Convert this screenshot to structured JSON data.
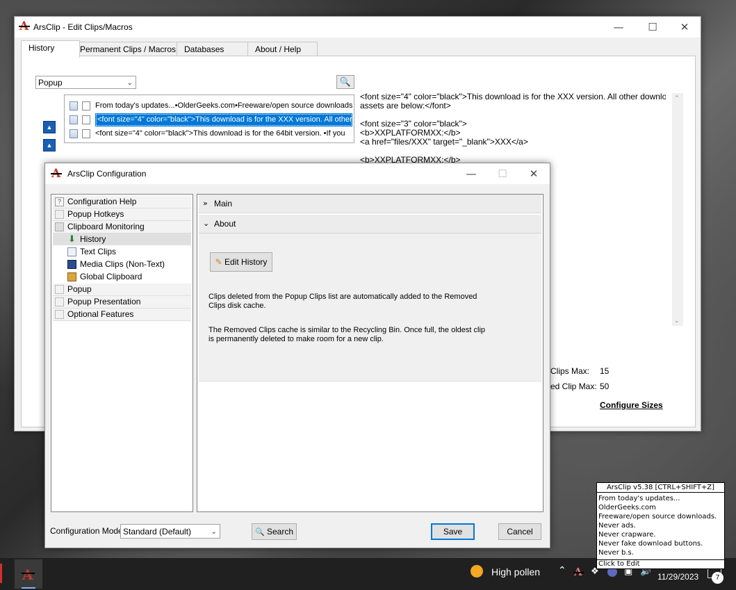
{
  "edit_window": {
    "title": "ArsClip - Edit Clips/Macros",
    "tabs": [
      "History",
      "Permanent Clips / Macros",
      "Databases",
      "About / Help"
    ],
    "active_tab": "History",
    "mode_combo": "Popup",
    "clips": [
      "From today's updates...•OlderGeeks.com•Freeware/open source downloads",
      "<font size=\"4\" color=\"black\">This download is for the XXX version. All other",
      "<font size=\"4\" color=\"black\">This download is for the 64bit version. •If you"
    ],
    "selected_clip": 1,
    "preview_text": "<font size=\"4\" color=\"black\">This download is for the XXX version. All other download\nassets are below:</font>\n\n<font size=\"3\" color=\"black\">\n<b>XXPLATFORMXX:</b>\n<a href=\"files/XXX\" target=\"_blank\">XXX</a>\n\n<b>XXPLATFORMXX:</b>",
    "clips_max_label": "Clips Max:",
    "clips_max_value": "15",
    "removed_max_label": "ed Clip Max:",
    "removed_max_value": "50",
    "configure_sizes": "Configure Sizes"
  },
  "config_dialog": {
    "title": "ArsClip Configuration",
    "tree": [
      {
        "label": "Configuration Help",
        "level": 0,
        "icon": "help-icon"
      },
      {
        "label": "Popup Hotkeys",
        "level": 0,
        "icon": "keyboard-icon"
      },
      {
        "label": "Clipboard Monitoring",
        "level": 0,
        "icon": "clipboard-icon"
      },
      {
        "label": "History",
        "level": 1,
        "icon": "download-icon",
        "selected": true
      },
      {
        "label": "Text Clips",
        "level": 1,
        "icon": "text-doc-icon"
      },
      {
        "label": "Media Clips (Non-Text)",
        "level": 1,
        "icon": "film-icon"
      },
      {
        "label": "Global Clipboard",
        "level": 1,
        "icon": "global-clipboard-icon"
      },
      {
        "label": "Popup",
        "level": 0,
        "icon": "popup-icon"
      },
      {
        "label": "Popup Presentation",
        "level": 0,
        "icon": "presentation-icon"
      },
      {
        "label": "Optional Features",
        "level": 0,
        "icon": "features-icon"
      }
    ],
    "sections": {
      "main": "Main",
      "about": "About"
    },
    "edit_history_button": "Edit History",
    "para1": "Clips deleted from the Popup Clips list are automatically added to the Removed Clips disk cache.",
    "para2": "The Removed Clips cache is similar to the Recycling Bin. Once full, the oldest clip is permanently deleted to make room for a new clip.",
    "config_mode_label": "Configuration Mode",
    "config_mode_value": "Standard (Default)",
    "search_button": "Search",
    "save_button": "Save",
    "cancel_button": "Cancel"
  },
  "taskbar": {
    "weather": "High pollen",
    "date": "11/29/2023",
    "notification_count": "7"
  },
  "popup": {
    "header": "ArsClip v5.38  [CTRL+SHIFT+Z]",
    "lines": [
      "From today's updates...",
      "OlderGeeks.com",
      "Freeware/open source downloads.",
      "Never ads.",
      "Never crapware.",
      "Never fake download buttons.",
      "Never b.s."
    ],
    "footer": "Click to Edit"
  },
  "colors": {
    "accent": "#0078d7",
    "logo_red": "#c0392b",
    "taskbar": "#202020"
  }
}
